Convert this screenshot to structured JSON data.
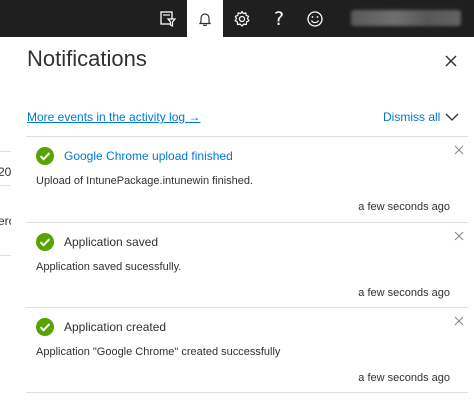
{
  "topbar": {
    "icons": [
      "filter-icon",
      "bell-icon",
      "gear-icon",
      "help-icon",
      "feedback-icon"
    ],
    "help_glyph": "?"
  },
  "background": {
    "fragment_1": "20",
    "fragment_2": "ero"
  },
  "panel": {
    "title": "Notifications",
    "activity_link": "More events in the activity log →",
    "dismiss_all": "Dismiss all"
  },
  "notifications": [
    {
      "title": "Google Chrome upload finished",
      "body": "Upload of IntunePackage.intunewin finished.",
      "time": "a few seconds ago"
    },
    {
      "title": "Application saved",
      "body": "Application saved sucessfully.",
      "time": "a few seconds ago"
    },
    {
      "title": "Application created",
      "body": "Application \"Google Chrome\" created successfully",
      "time": "a few seconds ago"
    }
  ],
  "colors": {
    "topbar": "#1f1f1f",
    "link": "#0078d4",
    "success": "#57a300"
  }
}
